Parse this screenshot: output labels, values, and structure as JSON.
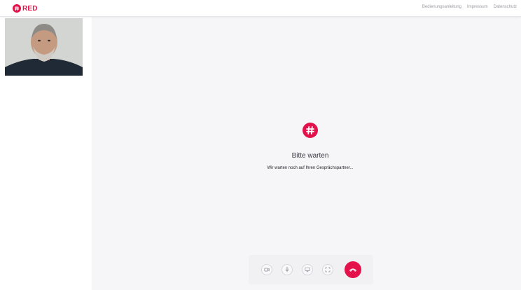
{
  "brand": {
    "name": "RED",
    "accent_color": "#e3124b"
  },
  "nav": {
    "links": [
      "Bedienungsanleitung",
      "Impressum",
      "Datenschutz"
    ]
  },
  "selfview": {
    "icon": "user-camera-feed"
  },
  "waiting": {
    "title": "Bitte warten",
    "subtitle": "Wir warten noch auf Ihren Gesprächspartner..."
  },
  "controls": {
    "buttons": [
      {
        "name": "camera",
        "icon": "video-camera-icon"
      },
      {
        "name": "microphone",
        "icon": "microphone-icon"
      },
      {
        "name": "screen-share",
        "icon": "monitor-icon"
      },
      {
        "name": "fullscreen",
        "icon": "fullscreen-icon"
      },
      {
        "name": "hang-up",
        "icon": "phone-hangup-icon"
      }
    ]
  }
}
